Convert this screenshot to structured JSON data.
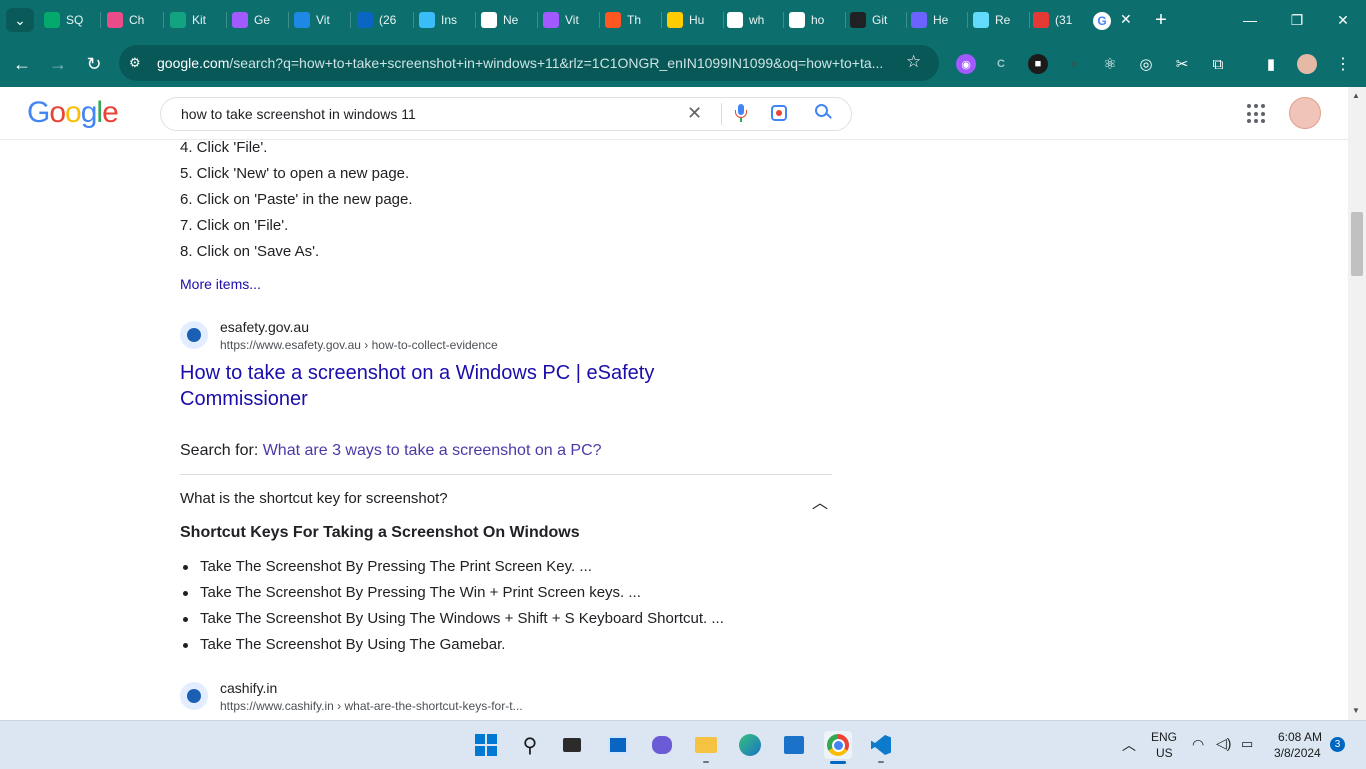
{
  "browser": {
    "tabs": [
      {
        "label": "SQ",
        "icon": "w3schools-icon",
        "color": "#04aa6d"
      },
      {
        "label": "Ch",
        "icon": "dribbble-icon",
        "color": "#ea4c89"
      },
      {
        "label": "Kit",
        "icon": "kit-icon",
        "color": "#14a37f"
      },
      {
        "label": "Ge",
        "icon": "vite-icon",
        "color": "#a259ff"
      },
      {
        "label": "Vit",
        "icon": "bolt-icon",
        "color": "#1e88e5"
      },
      {
        "label": "(26",
        "icon": "linkedin-icon",
        "color": "#0a66c2"
      },
      {
        "label": "Ins",
        "icon": "tailwind-icon",
        "color": "#38bdf8"
      },
      {
        "label": "Ne",
        "icon": "chrome-icon",
        "color": "#ffffff"
      },
      {
        "label": "Vit",
        "icon": "vite-icon",
        "color": "#a259ff"
      },
      {
        "label": "Th",
        "icon": "square-icon",
        "color": "#ff5722"
      },
      {
        "label": "Hu",
        "icon": "huggingface-icon",
        "color": "#ffcc00"
      },
      {
        "label": "wh",
        "icon": "google-icon",
        "color": "#ffffff"
      },
      {
        "label": "ho",
        "icon": "google-icon",
        "color": "#ffffff"
      },
      {
        "label": "Git",
        "icon": "github-icon",
        "color": "#202124"
      },
      {
        "label": "He",
        "icon": "feather-icon",
        "color": "#6c63ff"
      },
      {
        "label": "Re",
        "icon": "react-icon",
        "color": "#61dafb"
      },
      {
        "label": "(31",
        "icon": "badge-icon",
        "color": "#e53935"
      }
    ],
    "active_tab_icon": "google-icon",
    "new_tab": "+",
    "url_host": "google.com",
    "url_rest": "/search?q=how+to+take+screenshot+in+windows+11&rlz=1C1ONGR_enIN1099IN1099&oq=how+to+ta...",
    "accent": "#0d6e6e"
  },
  "google": {
    "logo": [
      "G",
      "o",
      "o",
      "g",
      "l",
      "e"
    ],
    "query": "how to take screenshot in windows 11"
  },
  "results": {
    "steps": [
      "4. Click 'File'.",
      "5. Click 'New' to open a new page.",
      "6. Click on 'Paste' in the new page.",
      "7. Click on 'File'.",
      "8. Click on 'Save As'."
    ],
    "more_items": "More items...",
    "result1": {
      "site": "esafety.gov.au",
      "url": "https://www.esafety.gov.au › how-to-collect-evidence",
      "title_line1": "How to take a screenshot on a Windows PC | eSafety",
      "title_line2": "Commissioner"
    },
    "search_for_label": "Search for: ",
    "search_for_link": "What are 3 ways to take a screenshot on a PC?",
    "question": "What is the shortcut key for screenshot?",
    "answer_heading": "Shortcut Keys For Taking a Screenshot On Windows",
    "bullets": [
      "Take The Screenshot By Pressing The Print Screen Key. ...",
      "Take The Screenshot By Pressing The Win + Print Screen keys. ...",
      "Take The Screenshot By Using The Windows + Shift + S Keyboard Shortcut. ...",
      "Take The Screenshot By Using The Gamebar."
    ],
    "result2": {
      "site": "cashify.in",
      "url": "https://www.cashify.in › what-are-the-shortcut-keys-for-t..."
    }
  },
  "taskbar": {
    "lang1": "ENG",
    "lang2": "US",
    "time": "6:08 AM",
    "date": "3/8/2024",
    "notifications": "3"
  }
}
